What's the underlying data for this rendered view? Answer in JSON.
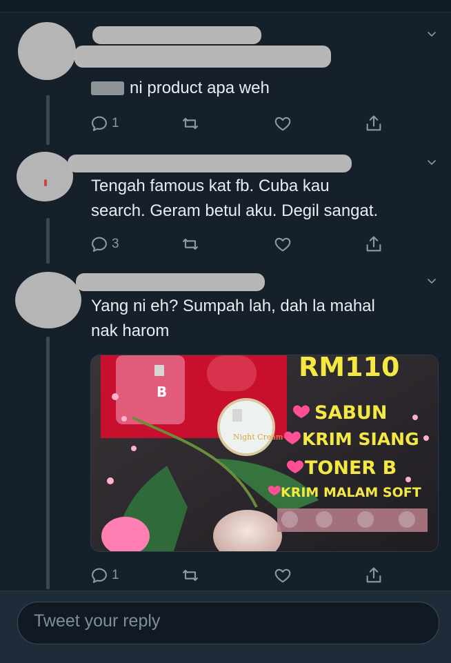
{
  "composer": {
    "placeholder": "Tweet your reply"
  },
  "tweets": [
    {
      "text": "ni product apa weh",
      "reply_count": "1"
    },
    {
      "text": "Tengah famous kat fb. Cuba kau\nsearch. Geram betul aku. Degil sangat.",
      "reply_count": "3"
    },
    {
      "text": "Yang ni eh? Sumpah lah, dah la mahal\nnak harom",
      "reply_count": "1"
    }
  ],
  "media_image": {
    "price": "RM110",
    "items": [
      "SABUN",
      "KRIM SIANG",
      "TONER B",
      "KRIM MALAM SOFT"
    ],
    "product_labels": [
      "B",
      "Night Cream"
    ]
  },
  "icons": {
    "reply": "reply-icon",
    "retweet": "retweet-icon",
    "like": "heart-icon",
    "share": "share-icon",
    "menu": "chevron-down-icon"
  },
  "colors": {
    "background": "#15202b",
    "text": "#e8edf1",
    "muted": "#8a9aa9",
    "composer": "#111a23",
    "price_yellow": "#f4e842",
    "heart_pink": "#ff4f95"
  }
}
